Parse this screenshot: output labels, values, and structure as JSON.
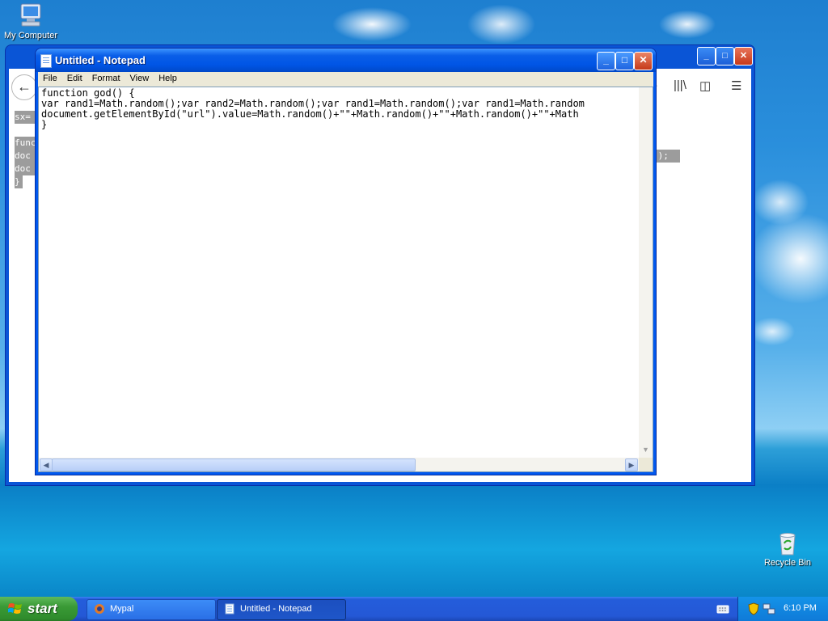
{
  "desktop": {
    "icons": [
      {
        "label": "My Computer",
        "icon": "my-computer-icon"
      },
      {
        "label": "Recycle Bin",
        "icon": "recycle-bin-icon"
      }
    ]
  },
  "browser": {
    "selected_code_fragments": [
      "sx=",
      "func",
      "doc",
      "doc",
      "}",
      "();"
    ]
  },
  "notepad": {
    "title": "Untitled - Notepad",
    "menu": [
      "File",
      "Edit",
      "Format",
      "View",
      "Help"
    ],
    "content_lines": [
      "function god() {",
      "var rand1=Math.random();var rand2=Math.random();var rand1=Math.random();var rand1=Math.random",
      "document.getElementById(\"url\").value=Math.random()+\"\"+Math.random()+\"\"+Math.random()+\"\"+Math",
      "}"
    ]
  },
  "taskbar": {
    "start_label": "start",
    "tasks": [
      {
        "label": "Mypal",
        "icon": "mypal-icon",
        "active": false
      },
      {
        "label": "Untitled - Notepad",
        "icon": "notepad-icon",
        "active": true
      }
    ],
    "clock": "6:10 PM"
  }
}
